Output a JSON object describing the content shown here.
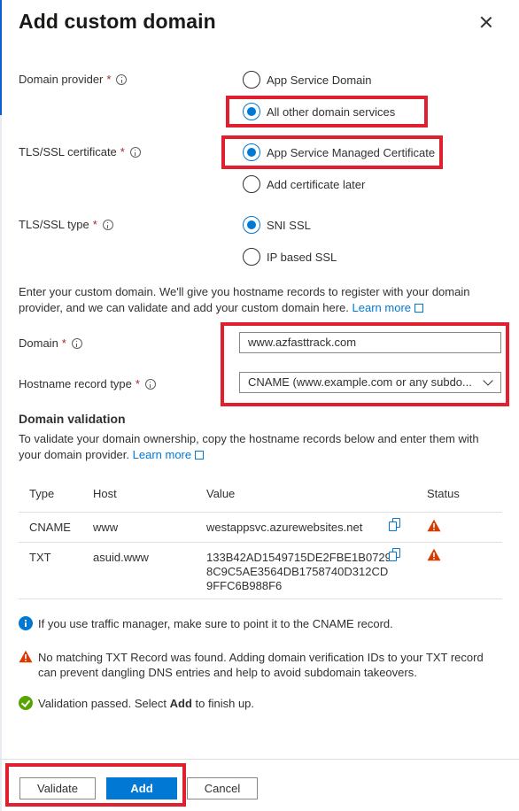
{
  "panel": {
    "title": "Add custom domain"
  },
  "domain_provider": {
    "label": "Domain provider",
    "required_mark": "*",
    "options": [
      "App Service Domain",
      "All other domain services"
    ],
    "selected": "All other domain services"
  },
  "tls_certificate": {
    "label": "TLS/SSL certificate",
    "required_mark": "*",
    "options": [
      "App Service Managed Certificate",
      "Add certificate later"
    ],
    "selected": "App Service Managed Certificate"
  },
  "tls_type": {
    "label": "TLS/SSL type",
    "required_mark": "*",
    "options": [
      "SNI SSL",
      "IP based SSL"
    ],
    "selected": "SNI SSL"
  },
  "intro": {
    "text": "Enter your custom domain. We'll give you hostname records to register with your domain provider, and we can validate and add your custom domain here.",
    "link": "Learn more"
  },
  "domain": {
    "label": "Domain",
    "required_mark": "*",
    "value": "www.azfasttrack.com"
  },
  "hostname_record_type": {
    "label": "Hostname record type",
    "required_mark": "*",
    "value": "CNAME (www.example.com or any subdo..."
  },
  "validation": {
    "heading": "Domain validation",
    "text": "To validate your domain ownership, copy the hostname records below and enter them with your domain provider.",
    "link": "Learn more",
    "columns": [
      "Type",
      "Host",
      "Value",
      "Status"
    ],
    "rows": [
      {
        "type": "CNAME",
        "host": "www",
        "value_lines": [
          "westappsvc.azurewebsites.net"
        ],
        "status": "warning"
      },
      {
        "type": "TXT",
        "host": "asuid.www",
        "value_lines": [
          "133B42AD1549715DE2FBE1B0729",
          "8C9C5AE3564DB1758740D312CD",
          "9FFC6B988F6"
        ],
        "status": "warning"
      }
    ]
  },
  "messages": {
    "info": "If you use traffic manager, make sure to point it to the CNAME record.",
    "warning": "No matching TXT Record was found. Adding domain verification IDs to your TXT record can prevent dangling DNS entries and help to avoid subdomain takeovers.",
    "success_prefix": "Validation passed. Select ",
    "success_bold": "Add",
    "success_suffix": " to finish up."
  },
  "footer": {
    "validate": "Validate",
    "add": "Add",
    "cancel": "Cancel"
  },
  "colors": {
    "accent": "#0078d4",
    "highlight": "#e0202e",
    "warning": "#d83b01",
    "success": "#57a300",
    "required": "#a4262c"
  }
}
